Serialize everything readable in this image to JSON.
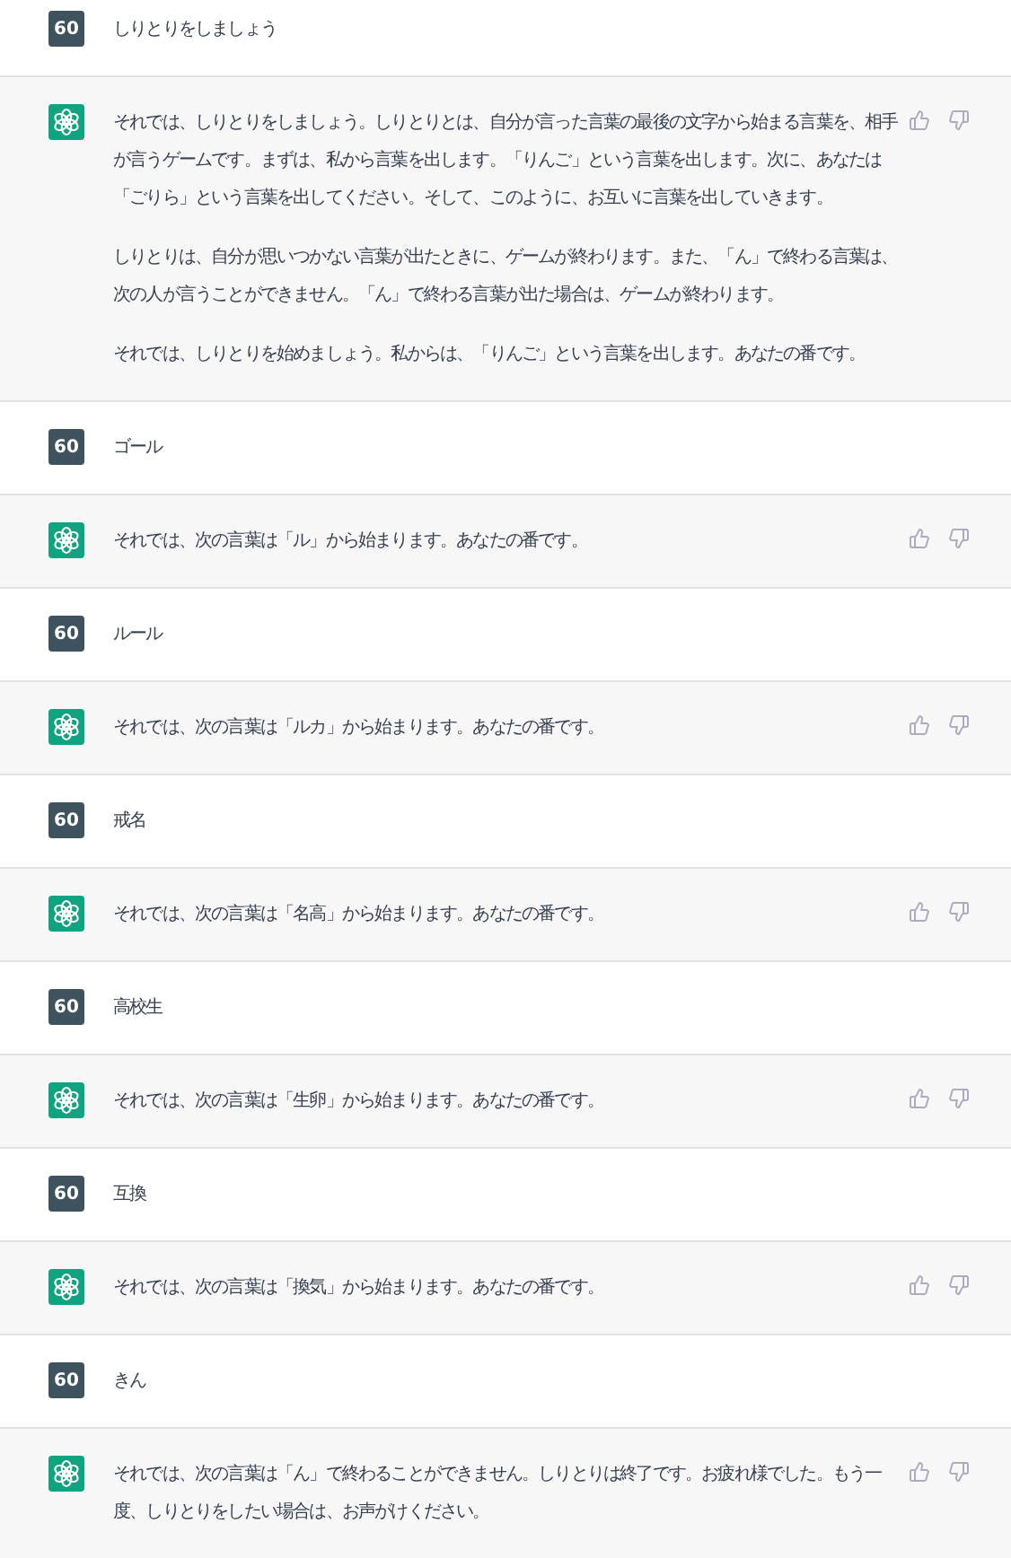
{
  "messages": [
    {
      "kind": "user",
      "avatar": "60",
      "paragraphs": [
        "しりとりをしましょう"
      ]
    },
    {
      "kind": "assistant",
      "paragraphs": [
        "それでは、しりとりをしましょう。しりとりとは、自分が言った言葉の最後の文字から始まる言葉を、相手が言うゲームです。まずは、私から言葉を出します。「りんご」という言葉を出します。次に、あなたは「ごりら」という言葉を出してください。そして、このように、お互いに言葉を出していきます。",
        "しりとりは、自分が思いつかない言葉が出たときに、ゲームが終わります。また、「ん」で終わる言葉は、次の人が言うことができません。「ん」で終わる言葉が出た場合は、ゲームが終わります。",
        "それでは、しりとりを始めましょう。私からは、「りんご」という言葉を出します。あなたの番です。"
      ]
    },
    {
      "kind": "user",
      "avatar": "60",
      "paragraphs": [
        "ゴール"
      ]
    },
    {
      "kind": "assistant",
      "paragraphs": [
        "それでは、次の言葉は「ル」から始まります。あなたの番です。"
      ]
    },
    {
      "kind": "user",
      "avatar": "60",
      "paragraphs": [
        "ルール"
      ]
    },
    {
      "kind": "assistant",
      "paragraphs": [
        "それでは、次の言葉は「ルカ」から始まります。あなたの番です。"
      ]
    },
    {
      "kind": "user",
      "avatar": "60",
      "paragraphs": [
        "戒名"
      ]
    },
    {
      "kind": "assistant",
      "paragraphs": [
        "それでは、次の言葉は「名高」から始まります。あなたの番です。"
      ]
    },
    {
      "kind": "user",
      "avatar": "60",
      "paragraphs": [
        "高校生"
      ]
    },
    {
      "kind": "assistant",
      "paragraphs": [
        "それでは、次の言葉は「生卵」から始まります。あなたの番です。"
      ]
    },
    {
      "kind": "user",
      "avatar": "60",
      "paragraphs": [
        "互換"
      ]
    },
    {
      "kind": "assistant",
      "paragraphs": [
        "それでは、次の言葉は「換気」から始まります。あなたの番です。"
      ]
    },
    {
      "kind": "user",
      "avatar": "60",
      "paragraphs": [
        "きん"
      ]
    },
    {
      "kind": "assistant",
      "paragraphs": [
        "それでは、次の言葉は「ん」で終わることができません。しりとりは終了です。お疲れ様でした。もう一度、しりとりをしたい場合は、お声がけください。"
      ]
    }
  ]
}
